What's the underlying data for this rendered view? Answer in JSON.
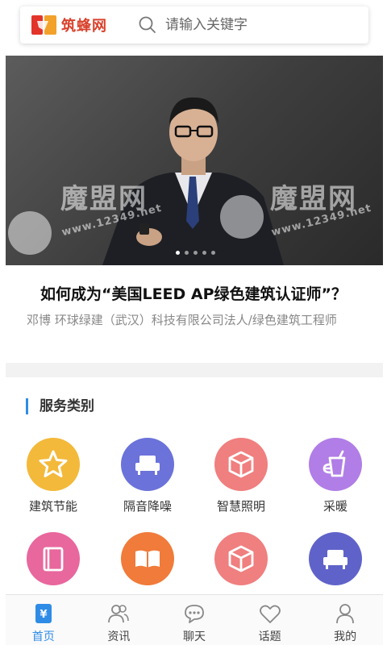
{
  "header": {
    "logo_text": "筑蜂网",
    "search_placeholder": "请输入关键字"
  },
  "banner": {
    "watermark_text": "魔盟网",
    "watermark_url": "www.12349.net",
    "dot_count": 5,
    "active_dot": 0
  },
  "article": {
    "title": "如何成为“美国LEED AP绿色建筑认证师”？",
    "subtitle": "邓博 环球绿建（武汉）科技有限公司法人/绿色建筑工程师"
  },
  "services": {
    "title": "服务类别",
    "items": [
      {
        "label": "建筑节能",
        "color": "#f3b93a",
        "icon": "star-icon"
      },
      {
        "label": "隔音降噪",
        "color": "#6b72d9",
        "icon": "sofa-icon"
      },
      {
        "label": "智慧照明",
        "color": "#f07f7f",
        "icon": "box-icon"
      },
      {
        "label": "采暖",
        "color": "#b07ee6",
        "icon": "cup-icon"
      },
      {
        "label": "",
        "color": "#e8679d",
        "icon": "book-icon"
      },
      {
        "label": "",
        "color": "#f07b3a",
        "icon": "open-book-icon"
      },
      {
        "label": "",
        "color": "#f07f7f",
        "icon": "box-icon"
      },
      {
        "label": "",
        "color": "#5f63c9",
        "icon": "sofa-icon"
      }
    ]
  },
  "tabbar": {
    "items": [
      {
        "label": "首页",
        "icon": "home-icon",
        "active": true
      },
      {
        "label": "资讯",
        "icon": "people-icon",
        "active": false
      },
      {
        "label": "聊天",
        "icon": "chat-icon",
        "active": false
      },
      {
        "label": "话题",
        "icon": "heart-icon",
        "active": false
      },
      {
        "label": "我的",
        "icon": "user-icon",
        "active": false
      }
    ]
  },
  "colors": {
    "accent": "#2f8ce6",
    "brand": "#d9412b"
  }
}
